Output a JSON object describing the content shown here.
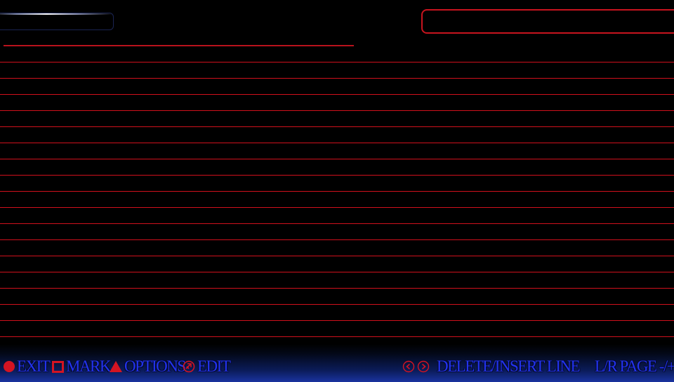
{
  "footer": {
    "exit": {
      "icon": "circle-button-icon",
      "label": "EXIT"
    },
    "mark": {
      "icon": "square-button-icon",
      "label": "MARK"
    },
    "options": {
      "icon": "triangle-button-icon",
      "label": "OPTIONS"
    },
    "edit": {
      "icon": "analog-stick-icon",
      "label": "EDIT"
    },
    "delete_insert": {
      "icons": [
        "left-arrow-icon",
        "right-arrow-icon"
      ],
      "label": "DELETE/INSERT LINE"
    },
    "page": {
      "label": "L/R PAGE -/+"
    }
  },
  "list": {
    "row_count": 18,
    "rows": [
      "",
      "",
      "",
      "",
      "",
      "",
      "",
      "",
      "",
      "",
      "",
      "",
      "",
      "",
      "",
      "",
      "",
      ""
    ]
  },
  "colors": {
    "background": "#000000",
    "accent_red": "#d0101c",
    "label_blue": "#2233ee",
    "footer_gradient_bottom": "#1a33a0"
  }
}
